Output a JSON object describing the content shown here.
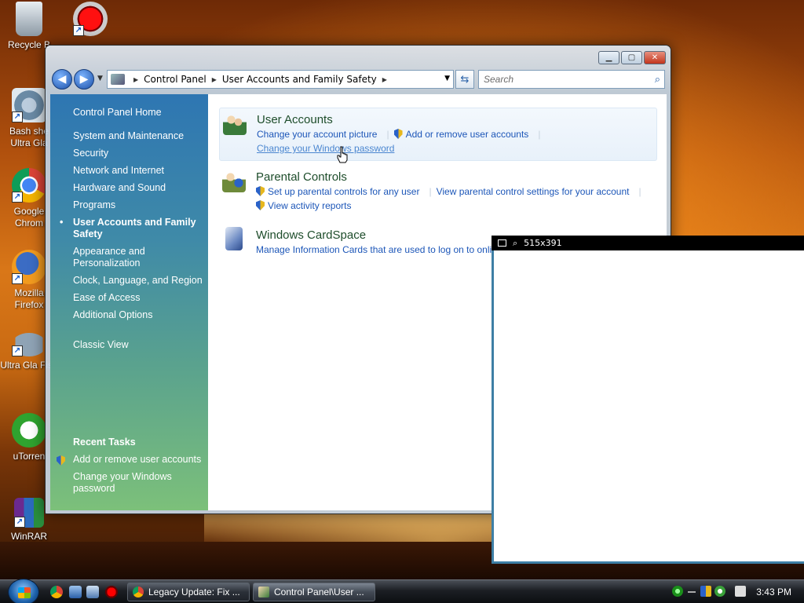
{
  "desktop": {
    "icons": [
      {
        "label": "Recycle B"
      },
      {
        "label": ""
      },
      {
        "label": "Bash she Ultra Gla"
      },
      {
        "label": "Google Chrom"
      },
      {
        "label": "Mozilla Firefox"
      },
      {
        "label": "Ultra Gla Fish"
      },
      {
        "label": "uTorren"
      },
      {
        "label": "WinRAR"
      }
    ]
  },
  "window": {
    "address": {
      "crumbs": [
        "Control Panel",
        "User Accounts and Family Safety"
      ]
    },
    "search_placeholder": "Search",
    "sidebar": {
      "home": "Control Panel Home",
      "items": [
        {
          "label": "System and Maintenance"
        },
        {
          "label": "Security"
        },
        {
          "label": "Network and Internet"
        },
        {
          "label": "Hardware and Sound"
        },
        {
          "label": "Programs"
        },
        {
          "label": "User Accounts and Family Safety"
        },
        {
          "label": "Appearance and Personalization"
        },
        {
          "label": "Clock, Language, and Region"
        },
        {
          "label": "Ease of Access"
        },
        {
          "label": "Additional Options"
        }
      ],
      "classic_view": "Classic View",
      "recent_tasks_title": "Recent Tasks",
      "recent_tasks": [
        {
          "label": "Add or remove user accounts"
        },
        {
          "label": "Change your Windows password"
        }
      ]
    },
    "categories": {
      "user_accounts": {
        "title": "User Accounts",
        "links": [
          "Change your account picture",
          "Add or remove user accounts",
          "Change your Windows password"
        ]
      },
      "parental_controls": {
        "title": "Parental Controls",
        "links": [
          "Set up parental controls for any user",
          "View parental control settings for your account",
          "View activity reports"
        ]
      },
      "cardspace": {
        "title": "Windows CardSpace",
        "links": [
          "Manage Information Cards that are used to log on to online services"
        ]
      }
    }
  },
  "magnifier": {
    "size_text": "515x391"
  },
  "taskbar": {
    "tasks": [
      {
        "label": "Legacy Update: Fix ..."
      },
      {
        "label": "Control Panel\\User ..."
      }
    ],
    "clock": "3:43 PM"
  },
  "colors": {
    "link": "#1c56b8",
    "category_title": "#1e4d2b",
    "magnifier_border": "#3e7fa5"
  }
}
